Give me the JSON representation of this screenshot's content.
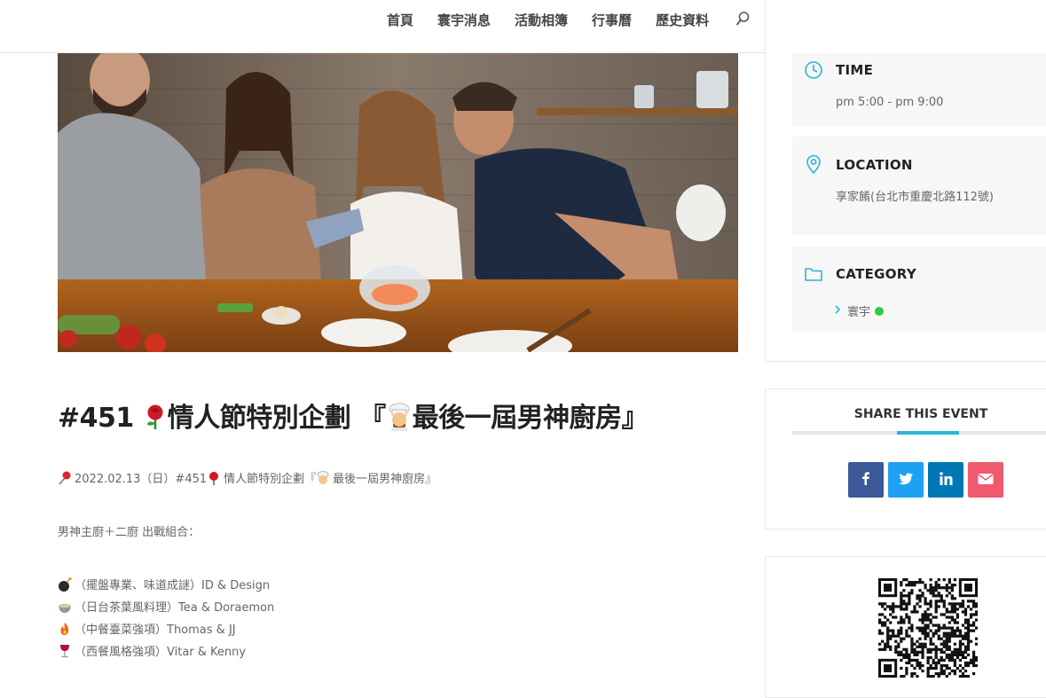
{
  "nav": {
    "items": [
      "首頁",
      "寰宇消息",
      "活動相簿",
      "行事曆",
      "歷史資料"
    ]
  },
  "hero": {
    "image": "people-cooking-in-kitchen-photo"
  },
  "article": {
    "title": "#451 🌹情人節特別企劃 『👨‍🍳最後一屆男神廚房』",
    "title_number": "#451",
    "title_part1": "情人節特別企劃 『",
    "title_part2": "最後一屆男神廚房』",
    "date_line_a": "2022.02.13（日）#451 ",
    "date_line_b": "情人節特別企劃『",
    "date_line_c": "最後一屆男神廚房』",
    "lineup_intro": "男神主廚＋二廚 出戰組合：",
    "teams": [
      {
        "icon": "bomb-icon",
        "text": "（擺盤專業、味道成謎）ID & Design"
      },
      {
        "icon": "tea-bowl-icon",
        "text": "（日台茶葉風料理）Tea & Doraemon"
      },
      {
        "icon": "fire-icon",
        "text": "（中餐臺菜強項）Thomas & JJ"
      },
      {
        "icon": "wine-glass-icon",
        "text": "（西餐風格強項）Vitar & Kenny"
      }
    ]
  },
  "sidebar": {
    "time": {
      "label": "TIME",
      "value": "pm 5:00 - pm 9:00"
    },
    "location": {
      "label": "LOCATION",
      "value": "享家餚(台北市重慶北路112號)"
    },
    "category": {
      "label": "CATEGORY",
      "value": "寰宇"
    },
    "share": {
      "title": "SHARE THIS EVENT"
    },
    "share_buttons": [
      {
        "name": "facebook",
        "color": "#3b5998",
        "glyph": "f"
      },
      {
        "name": "twitter",
        "color": "#1da1f2",
        "glyph": "t"
      },
      {
        "name": "linkedin",
        "color": "#0077b5",
        "glyph": "in"
      },
      {
        "name": "email",
        "color": "#ef5a6f",
        "glyph": "envelope"
      }
    ]
  },
  "colors": {
    "accent": "#29b6d6",
    "category_dot": "#2ecc40"
  }
}
